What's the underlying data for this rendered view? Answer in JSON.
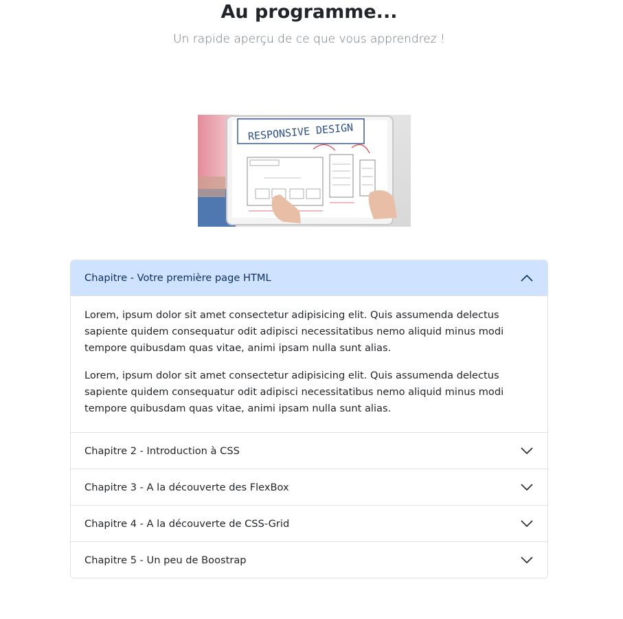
{
  "header": {
    "title": "Au programme...",
    "subtitle": "Un rapide aperçu de ce que vous apprendrez !"
  },
  "image": {
    "text": "RESPONSIVE DESIGN"
  },
  "accordion": {
    "items": [
      {
        "label": "Chapitre - Votre première page HTML",
        "expanded": true,
        "paragraphs": [
          "Lorem, ipsum dolor sit amet consectetur adipisicing elit. Quis assumenda delectus sapiente quidem consequatur odit adipisci necessitatibus nemo aliquid minus modi tempore quibusdam quas vitae, animi ipsam nulla sunt alias.",
          "Lorem, ipsum dolor sit amet consectetur adipisicing elit. Quis assumenda delectus sapiente quidem consequatur odit adipisci necessitatibus nemo aliquid minus modi tempore quibusdam quas vitae, animi ipsam nulla sunt alias."
        ]
      },
      {
        "label": "Chapitre 2 - Introduction à CSS",
        "expanded": false
      },
      {
        "label": "Chapitre 3 - A la découverte des FlexBox",
        "expanded": false
      },
      {
        "label": "Chapitre 4 - A la découverte de CSS-Grid",
        "expanded": false
      },
      {
        "label": "Chapitre 5 - Un peu de Boostrap",
        "expanded": false
      }
    ]
  },
  "colors": {
    "accent_bg": "#cfe2ff",
    "accent_text": "#0c2e5e",
    "border": "#dee2e6",
    "muted": "#6c757d"
  },
  "icons": {
    "expanded": "chevron-up-icon",
    "collapsed": "chevron-down-icon"
  }
}
